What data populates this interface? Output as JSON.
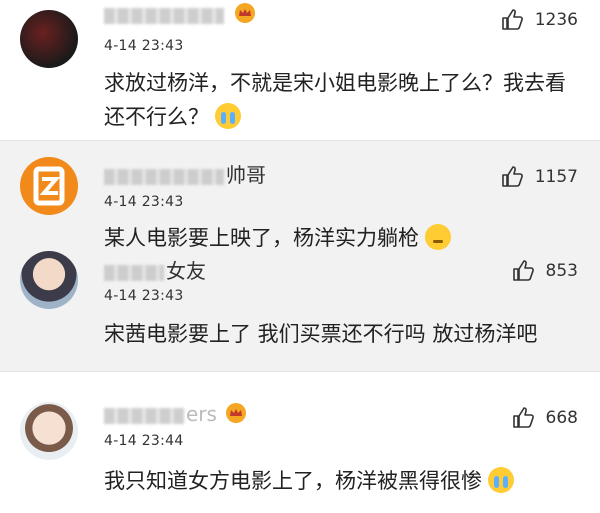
{
  "comments": [
    {
      "name_visible": "",
      "time": "4-14 23:43",
      "likes": "1236",
      "text": "求放过杨洋，不就是宋小姐电影晚上了么？我去看还不行么？",
      "emoji": "crying-face",
      "badge": "crown-badge"
    },
    {
      "name_visible": "帅哥",
      "time": "4-14 23:43",
      "likes": "1157",
      "text": "某人电影要上映了，杨洋实力躺枪",
      "emoji": "thinking-face"
    },
    {
      "name_visible": "女友",
      "time": "4-14 23:43",
      "likes": "853",
      "text": "宋茜电影要上了 我们买票还不行吗 放过杨洋吧"
    },
    {
      "name_visible": "ers",
      "time": "4-14 23:44",
      "likes": "668",
      "text": "我只知道女方电影上了，杨洋被黑得很惨",
      "emoji": "crying-face",
      "badge": "crown-badge"
    }
  ],
  "colors": {
    "accent": "#ffcc33",
    "text": "#222222",
    "meta": "#333333",
    "highlight_bg": "#f2f2f2"
  }
}
